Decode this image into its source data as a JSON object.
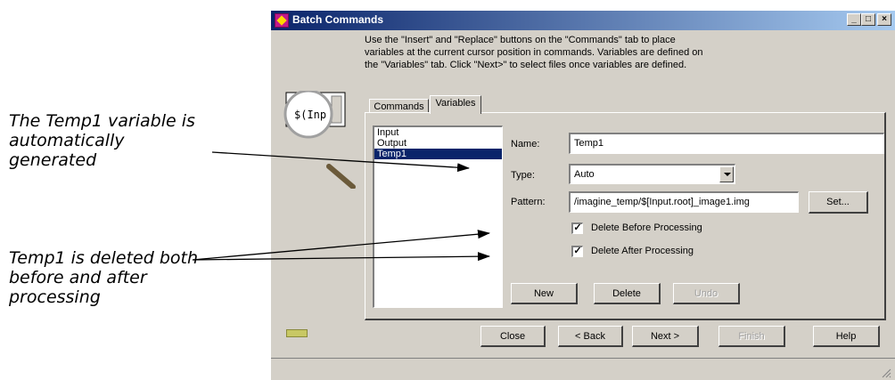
{
  "callouts": {
    "temp1_generated": [
      "The Temp1 variable is",
      "automatically",
      "generated"
    ],
    "temp1_deleted": [
      "Temp1 is deleted both",
      "before and after",
      "processing"
    ]
  },
  "window": {
    "title": "Batch Commands",
    "controls": {
      "minimize": "_",
      "maximize": "□",
      "close": "×"
    }
  },
  "instructions": [
    "Use the \"Insert\" and \"Replace\" buttons on the \"Commands\" tab to place",
    "variables at the current cursor position in commands. Variables are defined on",
    "the \"Variables\" tab. Click \"Next>\" to select files once variables are defined."
  ],
  "magnifier_text": "$(Inp",
  "tabs": [
    {
      "label": "Commands",
      "active": false
    },
    {
      "label": "Variables",
      "active": true
    }
  ],
  "variables": {
    "items": [
      "Input",
      "Output",
      "Temp1"
    ],
    "selected": "Temp1",
    "name_label": "Name:",
    "name_value": "Temp1",
    "type_label": "Type:",
    "type_value": "Auto",
    "pattern_label": "Pattern:",
    "pattern_value": "/imagine_temp/$[Input.root]_image1.img",
    "set_button": "Set...",
    "delete_before": {
      "label": "Delete Before Processing",
      "checked": true
    },
    "delete_after": {
      "label": "Delete After Processing",
      "checked": true
    },
    "new_button": "New",
    "delete_button": "Delete",
    "undo_button": "Undo"
  },
  "footer": {
    "close": "Close",
    "back": "< Back",
    "next": "Next >",
    "finish": "Finish",
    "help": "Help"
  },
  "colors": {
    "titlebar_start": "#0a246a",
    "titlebar_end": "#a6caf0",
    "face": "#d4d0c8",
    "selection": "#0a246a",
    "status_led": "#c8c864"
  }
}
